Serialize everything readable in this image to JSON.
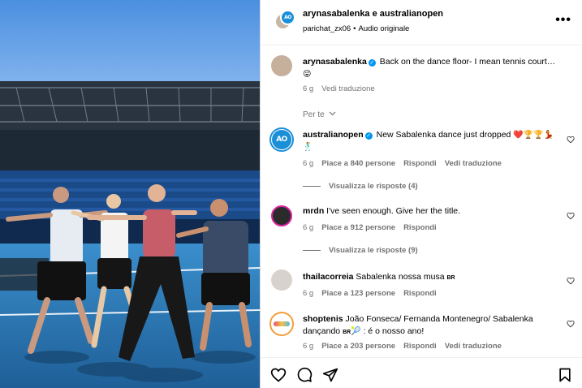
{
  "post": {
    "header_title": "arynasabalenka e australianopen",
    "header_user": "parichat_zx06",
    "header_audio": "Audio originale",
    "separator": "•",
    "more_label": "•••"
  },
  "caption": {
    "username": "arynasabalenka",
    "text": "Back on the dance floor- I mean tennis court…",
    "emoji": "😜",
    "time": "6 g",
    "translate": "Vedi traduzione"
  },
  "filter": {
    "label": "Per te",
    "icon": "chevron-down-icon"
  },
  "comments": [
    {
      "username": "australianopen",
      "verified": true,
      "text": "New Sabalenka dance just dropped",
      "emoji_line1": "❤️🏆🏆💃",
      "emoji_line2": "🕺",
      "time": "6 g",
      "likes": "Piace a 840 persone",
      "reply": "Rispondi",
      "translate": "Vedi traduzione",
      "view_replies": "Visualizza le risposte (4)",
      "avatar": "australian-open-logo",
      "ao_text": "AO"
    },
    {
      "username": "mrdn",
      "text": "I've seen enough. Give her the title.",
      "time": "6 g",
      "likes": "Piace a 912 persone",
      "reply": "Rispondi",
      "view_replies": "Visualizza le risposte (9)",
      "avatar": "profile-photo"
    },
    {
      "username": "thailacorreia",
      "text": "Sabalenka nossa musa",
      "flag": "BR",
      "time": "6 g",
      "likes": "Piace a 123 persone",
      "reply": "Rispondi",
      "avatar": "profile-photo"
    },
    {
      "username": "shoptenis",
      "text": "João Fonseca/ Fernanda Montenegro/ Sabalenka dançando",
      "flag": "BR",
      "emoji": "🎾",
      "text_end": ": é o nosso ano!",
      "time": "6 g",
      "likes": "Piace a 203 persone",
      "reply": "Rispondi",
      "translate": "Vedi traduzione",
      "avatar": "shop-logo"
    }
  ],
  "action_bar": {
    "icons": [
      "heart-icon",
      "comment-icon",
      "share-icon",
      "bookmark-icon"
    ]
  },
  "colors": {
    "verified_blue": "#0095f6",
    "ao_blue": "#1a8fd8",
    "secondary_text": "#737373",
    "court_blue": "#2a7fbf",
    "sky": "#5a9ae0"
  }
}
